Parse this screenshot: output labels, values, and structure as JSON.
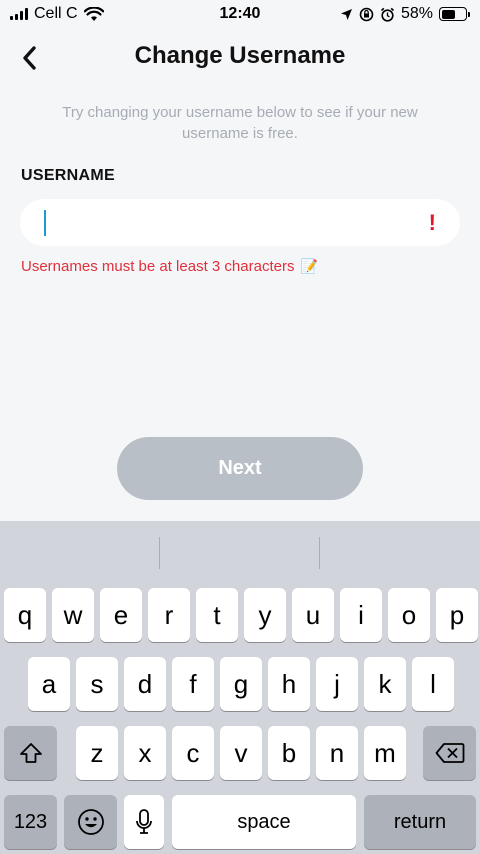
{
  "status_bar": {
    "carrier": "Cell C",
    "time": "12:40",
    "battery_percent": "58%",
    "battery_level": 0.58,
    "icons": [
      "signal-icon",
      "wifi-icon",
      "location-icon",
      "orientation-lock-icon",
      "alarm-icon",
      "battery-icon"
    ]
  },
  "header": {
    "title": "Change Username",
    "back_icon": "chevron-left-icon"
  },
  "subtitle": "Try changing your username below to see if your new username is free.",
  "form": {
    "label": "USERNAME",
    "value": "",
    "error_icon": "!",
    "error_text": "Usernames must be at least 3 characters",
    "error_emoji": "📝",
    "error_color": "#e0303c"
  },
  "next_button": {
    "label": "Next"
  },
  "keyboard": {
    "row1": [
      "q",
      "w",
      "e",
      "r",
      "t",
      "y",
      "u",
      "i",
      "o",
      "p"
    ],
    "row2": [
      "a",
      "s",
      "d",
      "f",
      "g",
      "h",
      "j",
      "k",
      "l"
    ],
    "row3": [
      "z",
      "x",
      "c",
      "v",
      "b",
      "n",
      "m"
    ],
    "numbers_label": "123",
    "space_label": "space",
    "return_label": "return",
    "shift_icon": "shift-icon",
    "delete_icon": "backspace-icon",
    "emoji_icon": "emoji-icon",
    "mic_icon": "microphone-icon"
  },
  "colors": {
    "background": "#f5f6f8",
    "accent_caret": "#1e9bd7",
    "button_disabled": "#b9bfc6",
    "keyboard_bg": "#d1d4da"
  }
}
